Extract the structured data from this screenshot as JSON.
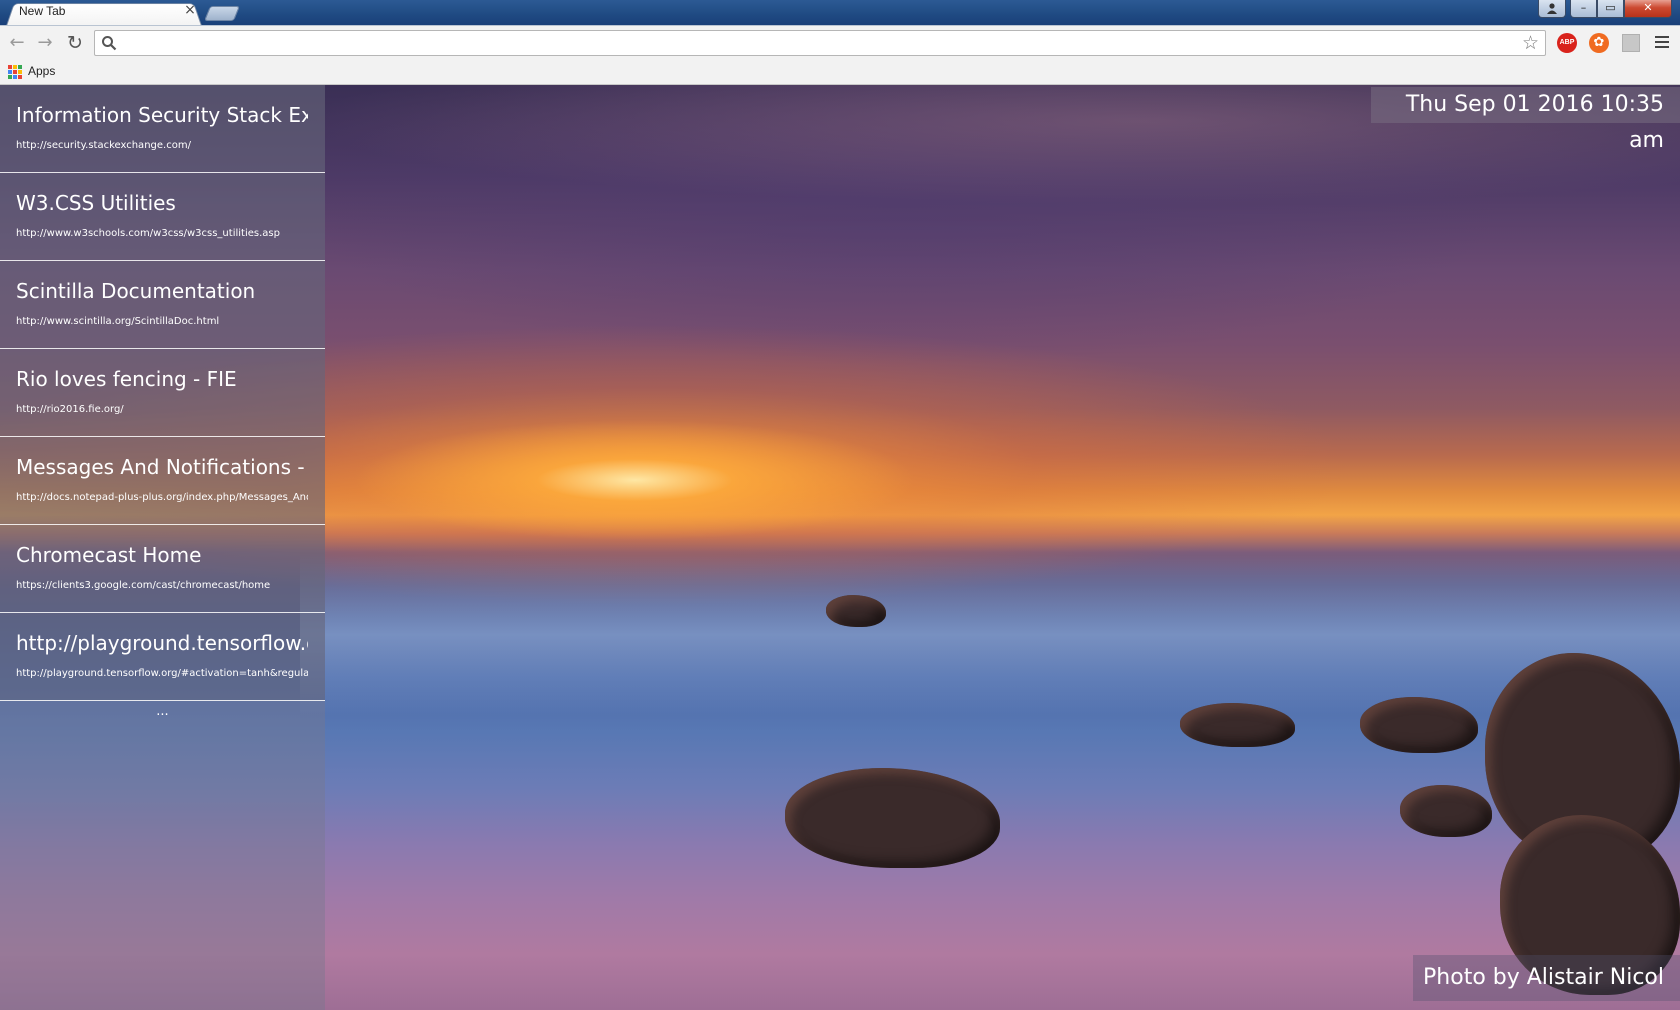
{
  "tab": {
    "title": "New Tab",
    "close_glyph": "×"
  },
  "window_controls": {
    "minimize": "–",
    "maximize": "▭",
    "close": "✕"
  },
  "toolbar": {
    "back_glyph": "←",
    "forward_glyph": "→",
    "reload_glyph": "↻",
    "omnibox_value": "",
    "star_glyph": "☆",
    "abp_label": "ABP",
    "ext2_glyph": "✿"
  },
  "bookmarks": {
    "apps_label": "Apps"
  },
  "colors": {
    "apps_dots": [
      "#e94235",
      "#fbbc05",
      "#34a853",
      "#4285f4",
      "#e94235",
      "#fbbc05",
      "#34a853",
      "#4285f4",
      "#e94235"
    ]
  },
  "sites": [
    {
      "title": "Information Security Stack Exchange",
      "url": "http://security.stackexchange.com/"
    },
    {
      "title": "W3.CSS Utilities",
      "url": "http://www.w3schools.com/w3css/w3css_utilities.asp"
    },
    {
      "title": "Scintilla Documentation",
      "url": "http://www.scintilla.org/ScintillaDoc.html"
    },
    {
      "title": "Rio loves fencing - FIE",
      "url": "http://rio2016.fie.org/"
    },
    {
      "title": "Messages And Notifications - Notepad++ Wiki",
      "url": "http://docs.notepad-plus-plus.org/index.php/Messages_And_Notifications"
    },
    {
      "title": "Chromecast Home",
      "url": "https://clients3.google.com/cast/chromecast/home"
    },
    {
      "title": "http://playground.tensorflow.org/",
      "url": "http://playground.tensorflow.org/#activation=tanh&regularization"
    }
  ],
  "more_label": "...",
  "clock_text": "Thu Sep 01 2016 10:35 am",
  "photo_credit": "Photo by Alistair Nicol"
}
